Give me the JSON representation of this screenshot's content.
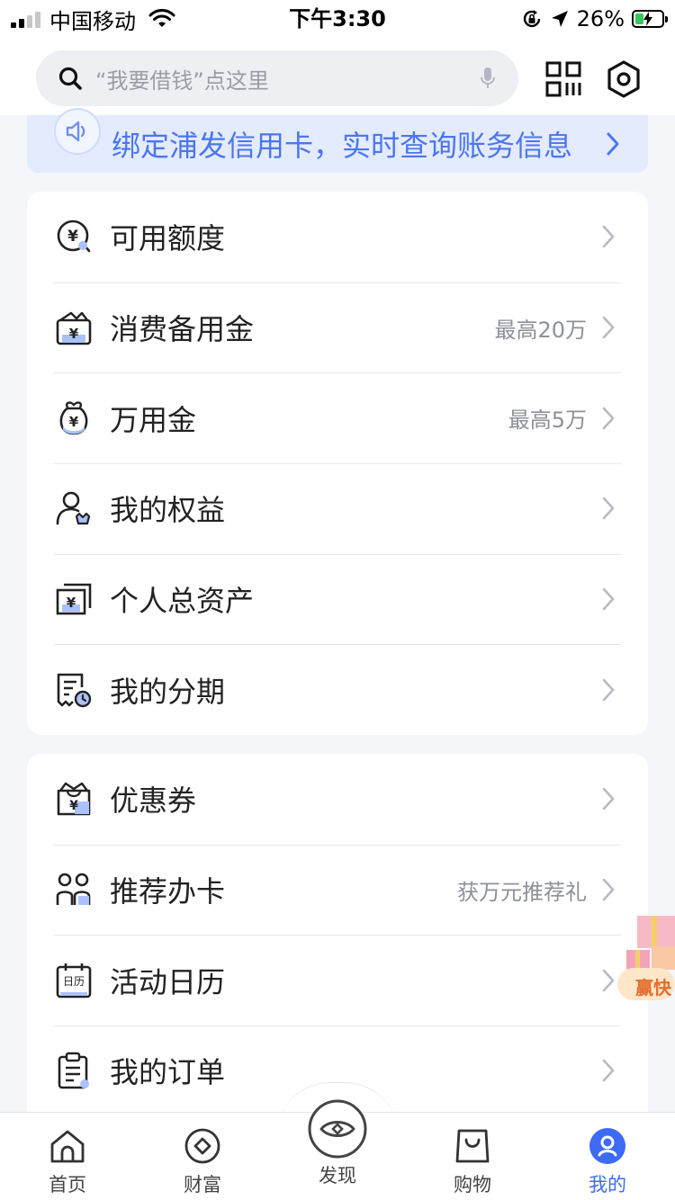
{
  "status_bar": {
    "carrier": "中国移动",
    "time": "下午3:30",
    "battery": "26%",
    "battery_level": 0.26
  },
  "search": {
    "placeholder": "“我要借钱”点这里"
  },
  "banner": {
    "text": "绑定浦发信用卡，实时查询账务信息"
  },
  "menu_group_1": [
    {
      "label": "可用额度",
      "note": "",
      "icon": "yuan-coin-icon"
    },
    {
      "label": "消费备用金",
      "note": "最高20万",
      "icon": "wallet-yuan-icon"
    },
    {
      "label": "万用金",
      "note": "最高5万",
      "icon": "money-bag-icon"
    },
    {
      "label": "我的权益",
      "note": "",
      "icon": "user-crown-icon"
    },
    {
      "label": "个人总资产",
      "note": "",
      "icon": "assets-card-icon"
    },
    {
      "label": "我的分期",
      "note": "",
      "icon": "installment-bill-icon"
    }
  ],
  "menu_group_2": [
    {
      "label": "优惠券",
      "note": "",
      "icon": "coupon-icon"
    },
    {
      "label": "推荐办卡",
      "note": "获万元推荐礼",
      "icon": "referral-users-icon"
    },
    {
      "label": "活动日历",
      "note": "",
      "icon": "calendar-icon",
      "icon_text": "日历"
    },
    {
      "label": "我的订单",
      "note": "",
      "icon": "order-clipboard-icon"
    }
  ],
  "promo": {
    "text": "赢快"
  },
  "tabbar": [
    {
      "label": "首页",
      "icon": "home-icon"
    },
    {
      "label": "财富",
      "icon": "wealth-icon"
    },
    {
      "label": "发现",
      "icon": "discover-eye-icon"
    },
    {
      "label": "购物",
      "icon": "shopping-bag-icon"
    },
    {
      "label": "我的",
      "icon": "user-icon",
      "active": true
    }
  ],
  "colors": {
    "accent": "#3d6bf5",
    "banner_bg": "#e4ebfd",
    "banner_text": "#4a76f0",
    "page_bg": "#f5f6fa"
  }
}
